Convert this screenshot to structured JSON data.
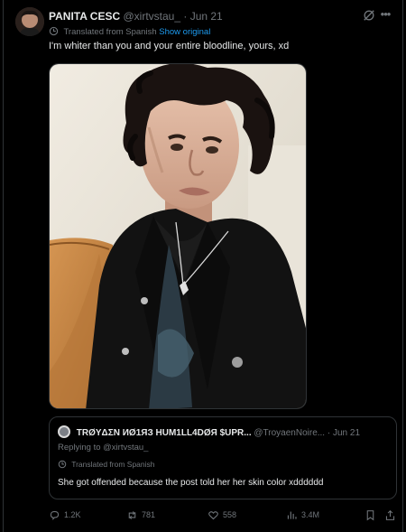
{
  "tweet": {
    "author_name": "PANITA CESC",
    "handle": "@xirtvstau_",
    "separator": "·",
    "date": "Jun 21",
    "translated_label": "Translated from Spanish",
    "show_original": "Show original",
    "text": "I'm whiter than you and your entire bloodline, yours, xd"
  },
  "quote": {
    "author_name": "TRØYΔΣN ИØ1ЯЗ HUM1LL4DØЯ $UPR...",
    "handle": "@TroyaenNoire...",
    "separator": "·",
    "date": "Jun 21",
    "replying_to": "Replying to @xirtvstau_",
    "translated_label": "Translated from Spanish",
    "text": "She got offended because the post told her her skin color xdddddd"
  },
  "actions": {
    "replies": "1.2K",
    "reposts": "781",
    "likes": "558",
    "views": "3.4M"
  },
  "colors": {
    "background": "#000000",
    "text": "#e7e9ea",
    "muted": "#71767b",
    "link": "#1d9bf0",
    "border": "#2f3336"
  }
}
